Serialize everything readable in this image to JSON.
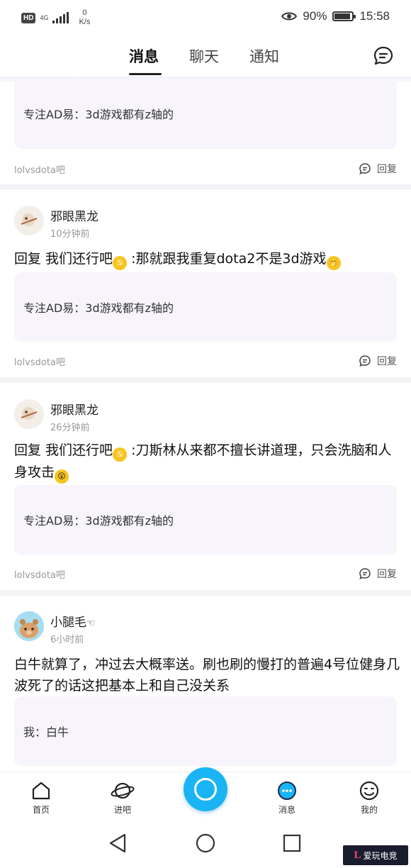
{
  "status_bar": {
    "hd": "HD",
    "network": "4G",
    "speed_value": "0",
    "speed_unit": "K/s",
    "battery": "90%",
    "time": "15:58"
  },
  "top_tabs": [
    "消息",
    "聊天",
    "通知"
  ],
  "feed": {
    "first_partial": {
      "quote": "专注AD易：3d游戏都有z轴的",
      "forum": "lolvsdota吧",
      "reply_label": "回复"
    },
    "items": [
      {
        "user": "邪眼黑龙",
        "time": "10分钟前",
        "prefix": "回复 我们还行吧",
        "text": ":那就跟我重复dota2不是3d游戏",
        "quote": "专注AD易：3d游戏都有z轴的",
        "forum": "lolvsdota吧",
        "reply_label": "回复"
      },
      {
        "user": "邪眼黑龙",
        "time": "26分钟前",
        "prefix": "回复 我们还行吧",
        "text": ":刀斯林从来都不擅长讲道理，只会洗脑和人身攻击",
        "quote": "专注AD易：3d游戏都有z轴的",
        "forum": "lolvsdota吧",
        "reply_label": "回复"
      },
      {
        "user": "小腿毛",
        "user_suffix": "☜",
        "time": "6小时前",
        "text": "白牛就算了，冲过去大概率送。刷也刷的慢打的普遍4号位健身几波死了的话这把基本上和自己没关系",
        "quote": "我：白牛"
      }
    ]
  },
  "bottom_nav": {
    "home": "首页",
    "forum": "进吧",
    "messages": "消息",
    "mine": "我的"
  },
  "watermark": {
    "mark": "L",
    "text": "爱玩电竞"
  },
  "colors": {
    "accent": "#1ab4f5",
    "quote_bg": "#f7f5fb",
    "divider": "#f4f4f7"
  }
}
